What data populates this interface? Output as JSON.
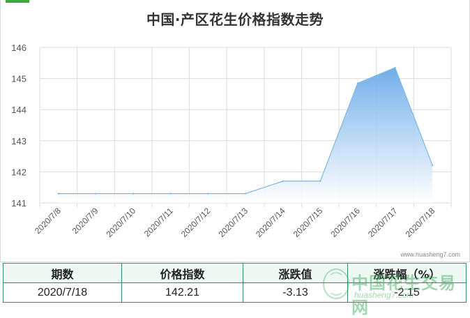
{
  "title": "中国·产区花生价格指数走势",
  "source_watermark": "www.huasheng7.com",
  "chart_data": {
    "type": "area",
    "title": "中国·产区花生价格指数走势",
    "xlabel": "",
    "ylabel": "",
    "categories": [
      "2020/7/8",
      "2020/7/9",
      "2020/7/10",
      "2020/7/11",
      "2020/7/12",
      "2020/7/13",
      "2020/7/14",
      "2020/7/15",
      "2020/7/16",
      "2020/7/17",
      "2020/7/18"
    ],
    "values": [
      141.3,
      141.3,
      141.3,
      141.3,
      141.3,
      141.3,
      141.7,
      141.7,
      144.85,
      145.35,
      142.21
    ],
    "ylim": [
      141,
      146
    ],
    "yticks": [
      141,
      142,
      143,
      144,
      145,
      146
    ],
    "grid": true,
    "colors": {
      "line": "#7db7e8",
      "fill_top": "#6aaae8",
      "fill_bottom": "#ffffff",
      "grid": "#dcdcdc"
    }
  },
  "summary_table": {
    "headers": [
      "期数",
      "价格指数",
      "涨跌值",
      "涨跌幅（%）"
    ],
    "row": [
      "2020/7/18",
      "142.21",
      "-3.13",
      "-2.15"
    ]
  },
  "brand": {
    "name": "中国花生交易网",
    "url": "huasheng7.com",
    "seal_text": "花生"
  }
}
